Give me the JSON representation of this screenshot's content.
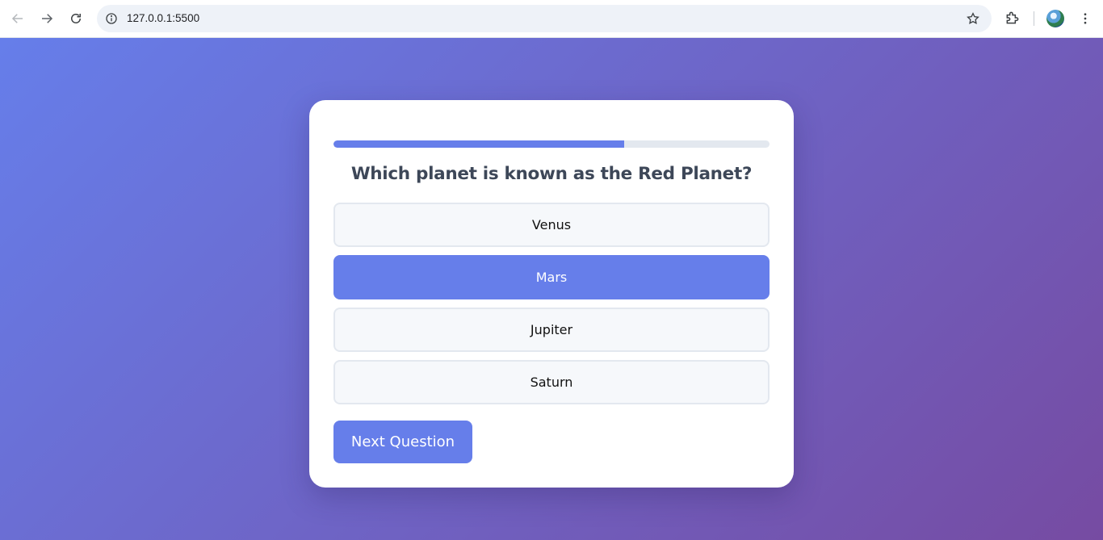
{
  "browser": {
    "url": "127.0.0.1:5500",
    "icons": {
      "back": "arrow-left-icon",
      "forward": "arrow-right-icon",
      "reload": "reload-icon",
      "site_info": "info-icon",
      "bookmark": "star-icon",
      "extensions": "puzzle-icon",
      "menu": "more-vert-icon"
    }
  },
  "quiz": {
    "progress_fraction": 0.667,
    "question": "Which planet is known as the Red Planet?",
    "options": [
      {
        "label": "Venus",
        "selected": false
      },
      {
        "label": "Mars",
        "selected": true
      },
      {
        "label": "Jupiter",
        "selected": false
      },
      {
        "label": "Saturn",
        "selected": false
      }
    ],
    "next_label": "Next Question"
  },
  "colors": {
    "accent": "#667eea",
    "gradient_start": "#667eea",
    "gradient_end": "#764ba2",
    "question_text": "#3d4758"
  }
}
